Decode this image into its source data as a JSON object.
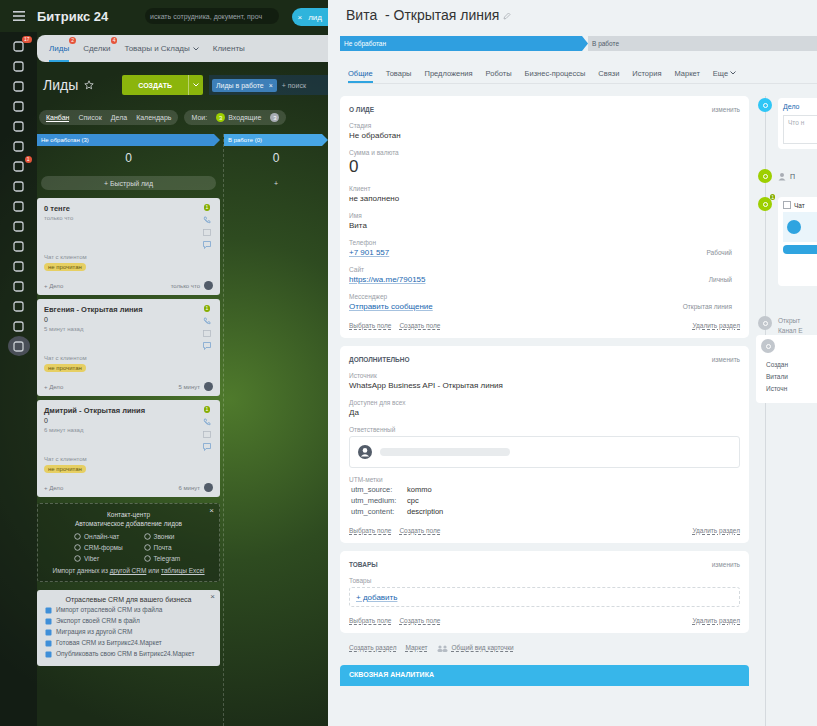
{
  "portal": {
    "logo": "Битрикс 24",
    "search_placeholder": "искать сотрудника, документ, проч",
    "slider_tab": {
      "close": "×",
      "label": "лид"
    }
  },
  "sidebar": {
    "items": [
      {
        "badge": "17",
        "active": false
      },
      {
        "active": false
      },
      {
        "active": false
      },
      {
        "active": false
      },
      {
        "active": false
      },
      {
        "active": false
      },
      {
        "badge": "1",
        "active": false
      },
      {
        "active": false
      },
      {
        "active": false
      },
      {
        "active": false
      },
      {
        "active": false
      },
      {
        "active": false
      },
      {
        "active": false
      },
      {
        "active": false
      },
      {
        "active": false
      },
      {
        "active": true
      }
    ]
  },
  "crm_tabs": [
    {
      "label": "Лиды",
      "badge": "2",
      "selected": true,
      "menu": false
    },
    {
      "label": "Сделки",
      "badge": "4",
      "selected": false,
      "menu": false
    },
    {
      "label": "Товары и Склады",
      "selected": false,
      "menu": true
    },
    {
      "label": "Клиенты",
      "selected": false,
      "menu": false
    }
  ],
  "toolbar": {
    "title": "Лиды",
    "create": "СОЗДАТЬ",
    "filter": "Лиды в работе",
    "filter_remove": "×",
    "search": "+ поиск"
  },
  "views": [
    {
      "label": "Канбан",
      "selected": true
    },
    {
      "label": "Список",
      "selected": false
    },
    {
      "label": "Дела",
      "selected": false
    },
    {
      "label": "Календарь",
      "selected": false
    }
  ],
  "counters": {
    "label": "Мои:",
    "items": [
      {
        "count": "3",
        "label": "Входящие",
        "color": "#9dcf00"
      },
      {
        "count": "3",
        "color": "#a8adb4"
      }
    ]
  },
  "columns": [
    {
      "title": "Не обработан (3)",
      "sum": "0",
      "add": "+ Быстрый лид",
      "color": "#3a8fd6"
    },
    {
      "title": "В работе (0)",
      "sum": "0",
      "add": "+",
      "color": "#47a6e6"
    }
  ],
  "cards": [
    {
      "title": "0 тенге",
      "time": "только что",
      "channel": "Чат с клиентом",
      "status": "не прочитан",
      "add": "+ Дело",
      "ago": "только что",
      "badge": "1"
    },
    {
      "title": "Евгения - Открытая линия",
      "sum": "0",
      "time": "5 минут назад",
      "channel": "Чат с клиентом",
      "status": "не прочитан",
      "add": "+ Дело",
      "ago": "5 минут",
      "badge": "1"
    },
    {
      "title": "Дмитрий - Открытая линия",
      "sum": "0",
      "time": "6 минут назад",
      "channel": "Чат с клиентом",
      "status": "не прочитан",
      "add": "+ Дело",
      "ago": "6 минут",
      "badge": "1"
    }
  ],
  "contact_center": {
    "title": "Контакт-центр",
    "subtitle": "Автоматическое добавление лидов",
    "close": "×",
    "channels": [
      "Онлайн-чат",
      "Звонки",
      "CRM-формы",
      "Почта",
      "Viber",
      "Telegram"
    ],
    "import": [
      {
        "text": "Импорт данных из ",
        "link": false
      },
      {
        "text": "другой CRM",
        "link": true
      },
      {
        "text": " или ",
        "link": false
      },
      {
        "text": "таблицы Excel",
        "link": true
      }
    ]
  },
  "industry": {
    "title": "Отраслевые CRM для вашего бизнеса",
    "close": "×",
    "items": [
      "Импорт отраслевой CRM из файла",
      "Экспорт своей CRM в файл",
      "Миграция из другой CRM",
      "Готовая CRM из Битрикс24.Маркет",
      "Опубликовать свою CRM в Битрикс24.Маркет"
    ]
  },
  "lead": {
    "title": "Вита  - Открытая линия",
    "stages": [
      {
        "label": "Не обработан",
        "selected": true
      },
      {
        "label": "В работе",
        "selected": false
      }
    ],
    "tabs": [
      {
        "label": "Общие",
        "selected": true,
        "menu": false
      },
      {
        "label": "Товары",
        "selected": false,
        "menu": false
      },
      {
        "label": "Предложения",
        "selected": false,
        "menu": false
      },
      {
        "label": "Роботы",
        "selected": false,
        "menu": false
      },
      {
        "label": "Бизнес-процессы",
        "selected": false,
        "menu": false
      },
      {
        "label": "Связи",
        "selected": false,
        "menu": false
      },
      {
        "label": "История",
        "selected": false,
        "menu": false
      },
      {
        "label": "Маркет",
        "selected": false,
        "menu": false
      },
      {
        "label": "Еще",
        "selected": false,
        "menu": true
      }
    ],
    "sections": [
      {
        "title": "О ЛИДЕ",
        "edit": "изменить",
        "fields": [
          {
            "kind": "text",
            "label": "Стадия",
            "value": "Не обработан"
          },
          {
            "kind": "sum",
            "label": "Сумма и валюта",
            "value": "0"
          },
          {
            "kind": "text",
            "label": "Клиент",
            "value": "не заполнено"
          },
          {
            "kind": "text",
            "label": "Имя",
            "value": "Вита"
          },
          {
            "kind": "link",
            "label": "Телефон",
            "value": "+7 901 557",
            "type": "Рабочий"
          },
          {
            "kind": "link",
            "label": "Сайт",
            "value": "https://wa.me/790155",
            "type": "Личный"
          },
          {
            "kind": "link",
            "label": "Мессенджер",
            "value": "Отправить сообщение",
            "type": "Открытая линия"
          }
        ],
        "actions": [
          "Выбрать поле",
          "Создать поле"
        ],
        "remove": "Удалить раздел"
      },
      {
        "title": "ДОПОЛНИТЕЛЬНО",
        "edit": "изменить",
        "fields": [
          {
            "kind": "text",
            "label": "Источник",
            "value": "WhatsApp Business API - Открытая линия"
          },
          {
            "kind": "text",
            "label": "Доступен для всех",
            "value": "Да"
          },
          {
            "kind": "user",
            "label": "Ответственный"
          },
          {
            "kind": "utm",
            "label": "UTM-метки",
            "pairs": [
              {
                "key": "utm_source:",
                "value": "kommo"
              },
              {
                "key": "utm_medium:",
                "value": "cpc"
              },
              {
                "key": "utm_content:",
                "value": "description"
              }
            ]
          }
        ],
        "actions": [
          "Выбрать поле",
          "Создать поле"
        ],
        "remove": "Удалить раздел"
      },
      {
        "title": "ТОВАРЫ",
        "edit": "изменить",
        "fields": [
          {
            "kind": "products",
            "label": "Товары",
            "value": "+ добавить"
          }
        ],
        "actions": [
          "Выбрать поле",
          "Создать поле"
        ],
        "remove": "Удалить раздел"
      }
    ],
    "bottom_links": [
      {
        "label": "Создать раздел",
        "icon": false
      },
      {
        "label": "Маркет",
        "icon": false
      },
      {
        "label": "Общий вид карточки",
        "icon": true
      }
    ],
    "analytics": "СКВОЗНАЯ АНАЛИТИКА"
  },
  "timeline": {
    "items": [
      {
        "kind": "editor",
        "tab": "Дело",
        "placeholder": "Что н",
        "color": "#2fc6f6"
      },
      {
        "kind": "action",
        "label": "П",
        "color": "#9dcf00"
      },
      {
        "kind": "chat",
        "label": "Чат",
        "checked": false,
        "badge": "1",
        "color": "#9dcf00"
      },
      {
        "kind": "info",
        "lines": [
          "Открыт",
          "Канал Е"
        ],
        "color": "#c2c7cd"
      },
      {
        "kind": "card",
        "lines": [
          "Создан",
          "Витали",
          "Источн"
        ],
        "color": "#c2c7cd"
      }
    ]
  }
}
